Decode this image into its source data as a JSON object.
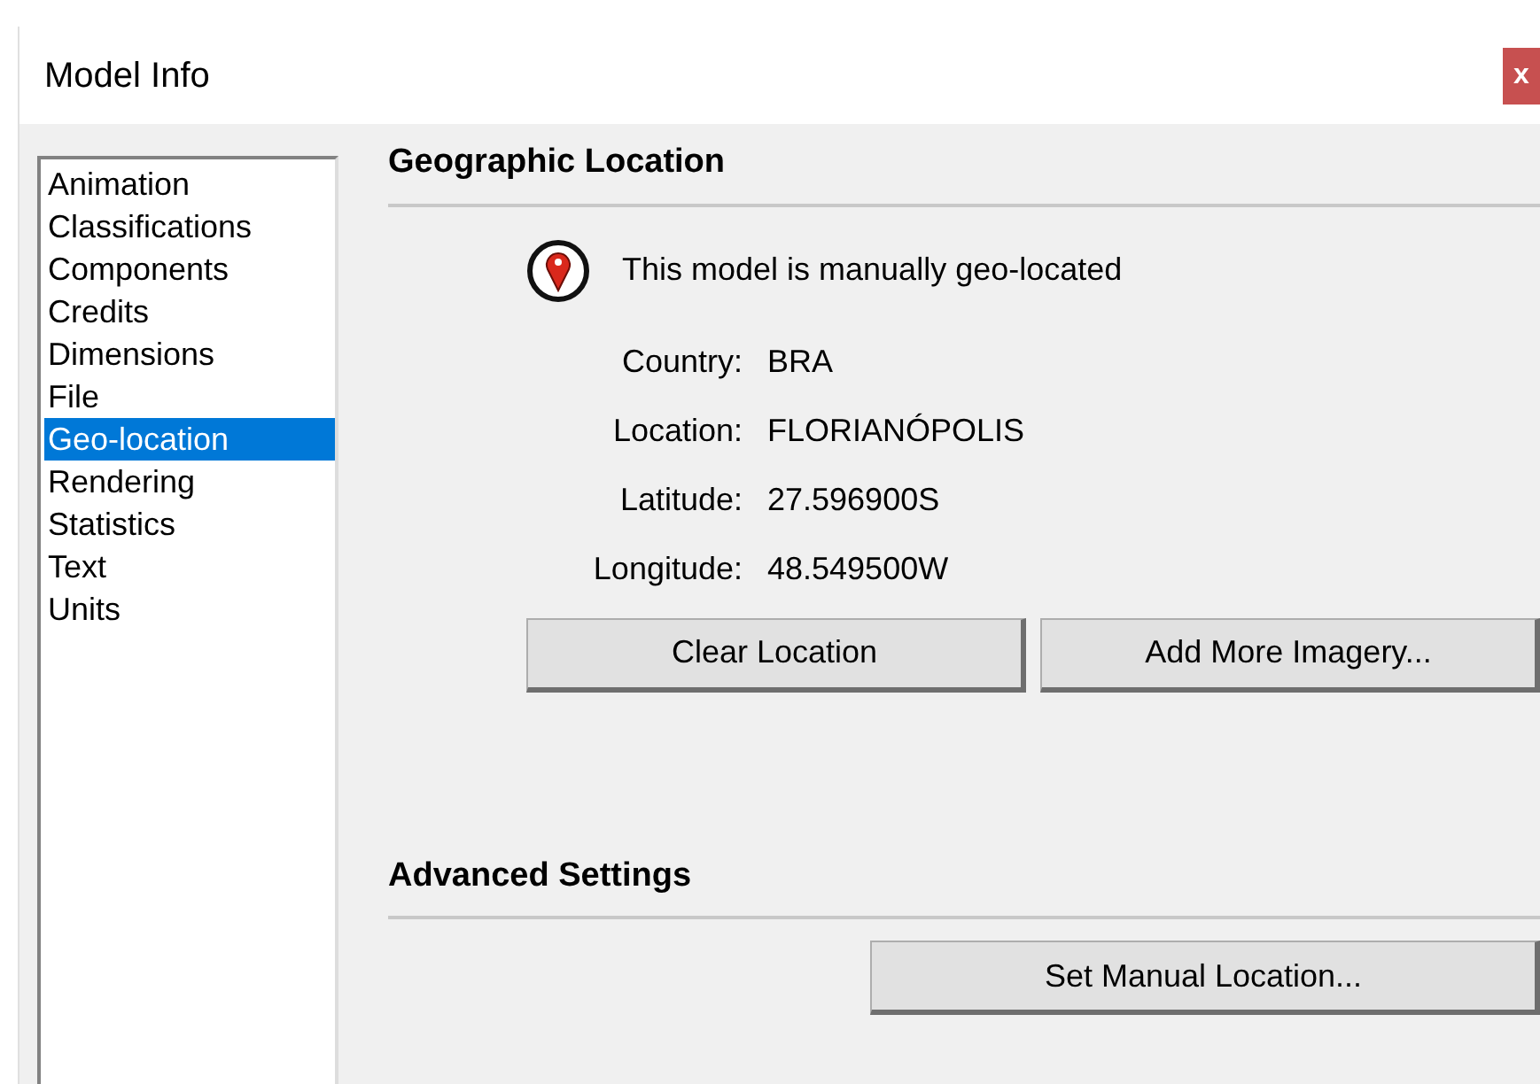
{
  "window": {
    "title": "Model Info",
    "close": "x"
  },
  "sidebar": {
    "items": [
      {
        "label": "Animation",
        "selected": false
      },
      {
        "label": "Classifications",
        "selected": false
      },
      {
        "label": "Components",
        "selected": false
      },
      {
        "label": "Credits",
        "selected": false
      },
      {
        "label": "Dimensions",
        "selected": false
      },
      {
        "label": "File",
        "selected": false
      },
      {
        "label": "Geo-location",
        "selected": true
      },
      {
        "label": "Rendering",
        "selected": false
      },
      {
        "label": "Statistics",
        "selected": false
      },
      {
        "label": "Text",
        "selected": false
      },
      {
        "label": "Units",
        "selected": false
      }
    ]
  },
  "geographic_location": {
    "heading": "Geographic Location",
    "status": "This model is manually geo-located",
    "fields": [
      {
        "label": "Country:",
        "value": "BRA"
      },
      {
        "label": "Location:",
        "value": "FLORIANÓPOLIS"
      },
      {
        "label": "Latitude:",
        "value": "27.596900S"
      },
      {
        "label": "Longitude:",
        "value": "48.549500W"
      }
    ],
    "buttons": [
      "Clear Location",
      "Add More Imagery..."
    ]
  },
  "advanced_settings": {
    "heading": "Advanced Settings",
    "buttons": [
      "Set Manual Location..."
    ]
  }
}
